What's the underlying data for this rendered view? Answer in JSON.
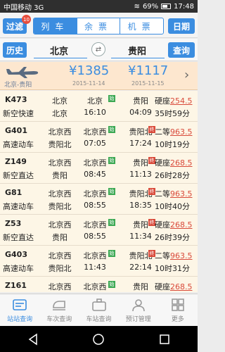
{
  "status": {
    "carrier": "中国移动 3G",
    "battery": "69%",
    "time": "17:48"
  },
  "toolbar": {
    "filter_label": "过滤",
    "filter_badge": "10",
    "tabs": [
      "列车",
      "余票",
      "机票"
    ],
    "date_label": "日期"
  },
  "stations": {
    "history_label": "历史",
    "from": "北京",
    "to": "贵阳",
    "query_label": "查询"
  },
  "flight": {
    "route": "北京-贵阳",
    "prices": [
      {
        "price": "¥1385",
        "date": "2015-11-14"
      },
      {
        "price": "¥1117",
        "date": "2015-11-15"
      }
    ]
  },
  "trains": [
    {
      "code": "K473",
      "kind": "新空快速",
      "from_st": "北京",
      "from_term": "北京",
      "board": "北京",
      "dep": "16:10",
      "arrive_st": "贵阳",
      "arr": "04:09",
      "seat": "硬座",
      "price": "254.5",
      "duration": "35时59分",
      "start_tag": "始",
      "end_tag": ""
    },
    {
      "code": "G401",
      "kind": "高速动车",
      "from_st": "北京西",
      "from_term": "贵阳北",
      "board": "北京西",
      "dep": "07:05",
      "arrive_st": "贵阳北",
      "arr": "17:24",
      "seat": "二等",
      "price": "963.5",
      "duration": "10时19分",
      "start_tag": "始",
      "end_tag": "终"
    },
    {
      "code": "Z149",
      "kind": "新空直达",
      "from_st": "北京西",
      "from_term": "贵阳",
      "board": "北京西",
      "dep": "08:45",
      "arrive_st": "贵阳",
      "arr": "11:13",
      "seat": "硬座",
      "price": "268.5",
      "duration": "26时28分",
      "start_tag": "始",
      "end_tag": "终"
    },
    {
      "code": "G81",
      "kind": "高速动车",
      "from_st": "北京西",
      "from_term": "贵阳北",
      "board": "北京西",
      "dep": "08:55",
      "arrive_st": "贵阳北",
      "arr": "18:35",
      "seat": "二等",
      "price": "963.5",
      "duration": "10时40分",
      "start_tag": "始",
      "end_tag": "终"
    },
    {
      "code": "Z53",
      "kind": "新空直达",
      "from_st": "北京西",
      "from_term": "贵阳",
      "board": "北京西",
      "dep": "08:55",
      "arrive_st": "贵阳",
      "arr": "11:34",
      "seat": "硬座",
      "price": "268.5",
      "duration": "26时39分",
      "start_tag": "始",
      "end_tag": "终"
    },
    {
      "code": "G403",
      "kind": "高速动车",
      "from_st": "北京西",
      "from_term": "贵阳北",
      "board": "北京西",
      "dep": "11:43",
      "arrive_st": "贵阳北",
      "arr": "22:14",
      "seat": "二等",
      "price": "963.5",
      "duration": "10时31分",
      "start_tag": "始",
      "end_tag": "终"
    },
    {
      "code": "Z161",
      "kind": "",
      "from_st": "北京西",
      "from_term": "",
      "board": "北京西",
      "dep": "",
      "arrive_st": "贵阳",
      "arr": "",
      "seat": "硬座",
      "price": "268.5",
      "duration": "",
      "start_tag": "始",
      "end_tag": ""
    }
  ],
  "tabbar": [
    "站站查询",
    "车次查询",
    "车站查询",
    "预订管理",
    "更多"
  ]
}
